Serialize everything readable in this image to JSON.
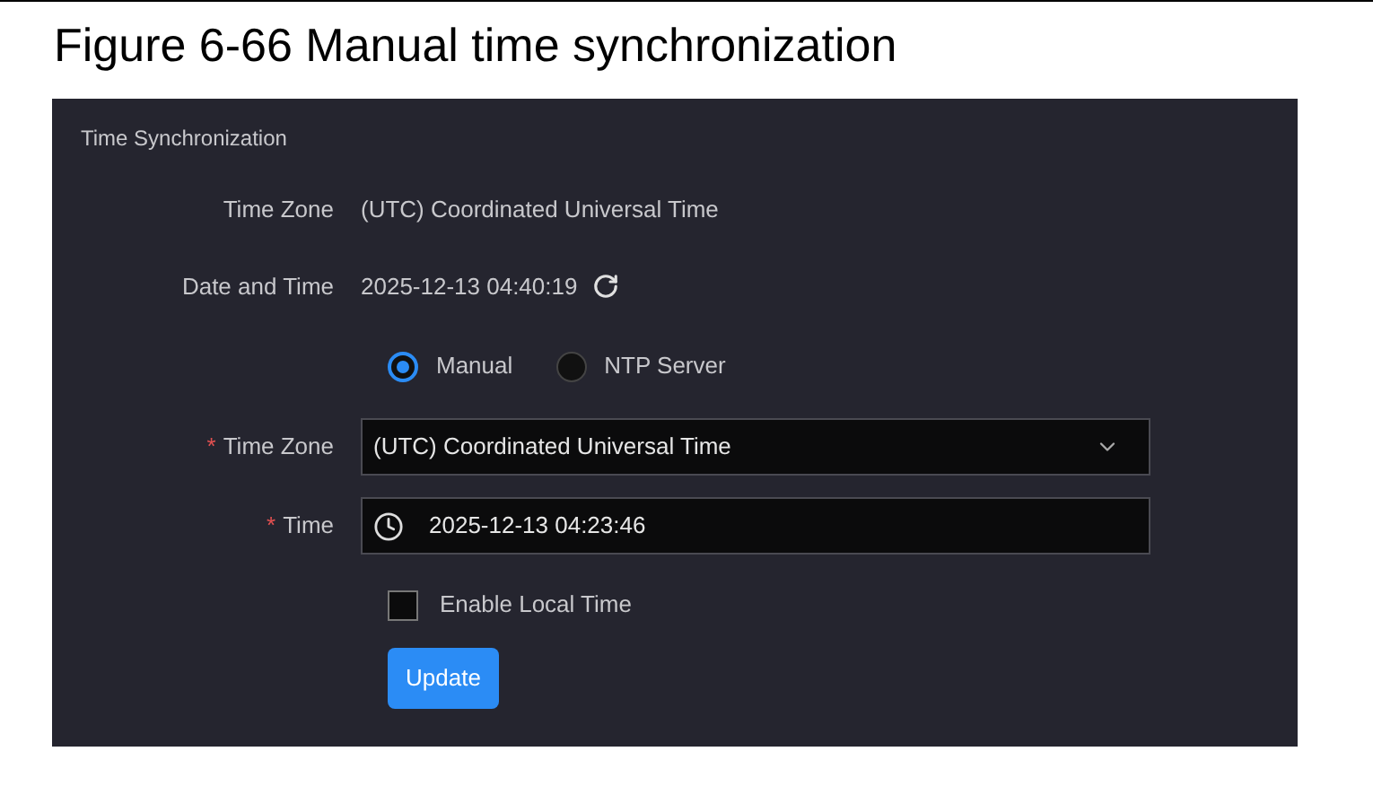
{
  "figure_caption": "Figure 6-66 Manual time synchronization",
  "panel": {
    "title": "Time Synchronization",
    "info_rows": [
      {
        "label": "Time Zone",
        "value": "(UTC) Coordinated Universal Time",
        "refresh": false
      },
      {
        "label": "Date and Time",
        "value": "2025-12-13 04:40:19",
        "refresh": true
      }
    ],
    "modes": [
      {
        "label": "Manual",
        "selected": true
      },
      {
        "label": "NTP Server",
        "selected": false
      }
    ],
    "fields": [
      {
        "kind": "select",
        "label": "Time Zone",
        "required_mark": "*",
        "value": "(UTC) Coordinated Universal Time"
      },
      {
        "kind": "time",
        "label": "Time",
        "required_mark": "*",
        "value": "2025-12-13 04:23:46"
      }
    ],
    "local_time": {
      "label": "Enable Local Time",
      "checked": false
    },
    "button": "Update"
  }
}
